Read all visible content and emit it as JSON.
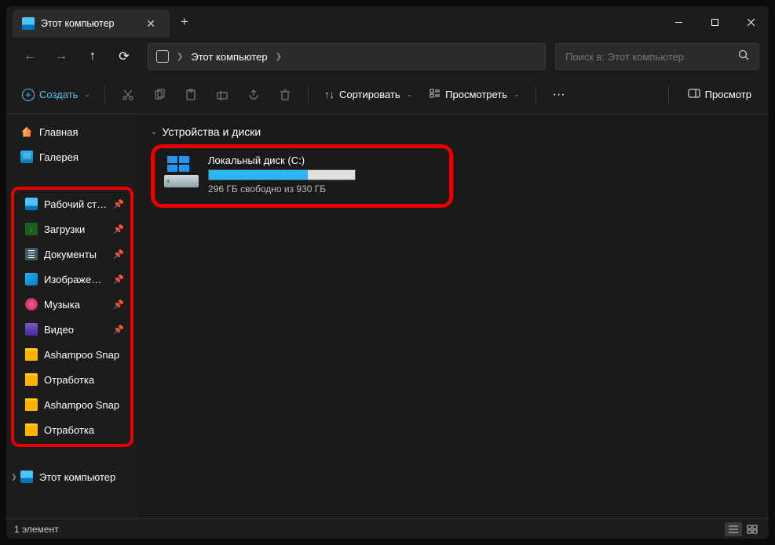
{
  "tab": {
    "title": "Этот компьютер"
  },
  "breadcrumb": {
    "location": "Этот компьютер"
  },
  "search": {
    "placeholder": "Поиск в: Этот компьютер"
  },
  "toolbar": {
    "create": "Создать",
    "sort": "Сортировать",
    "view": "Просмотреть",
    "preview": "Просмотр"
  },
  "sidebar": {
    "top": [
      {
        "label": "Главная",
        "icon": "home"
      },
      {
        "label": "Галерея",
        "icon": "gallery"
      }
    ],
    "pinned": [
      {
        "label": "Рабочий стол",
        "icon": "desktop",
        "pin": true
      },
      {
        "label": "Загрузки",
        "icon": "download",
        "pin": true
      },
      {
        "label": "Документы",
        "icon": "docs",
        "pin": true
      },
      {
        "label": "Изображения",
        "icon": "images",
        "pin": true
      },
      {
        "label": "Музыка",
        "icon": "music",
        "pin": true
      },
      {
        "label": "Видео",
        "icon": "video",
        "pin": true
      },
      {
        "label": "Ashampoo Snap",
        "icon": "folder",
        "pin": false
      },
      {
        "label": "Отработка",
        "icon": "folder",
        "pin": false
      },
      {
        "label": "Ashampoo Snap",
        "icon": "folder",
        "pin": false
      },
      {
        "label": "Отработка",
        "icon": "folder",
        "pin": false
      }
    ],
    "bottom": [
      {
        "label": "Этот компьютер",
        "icon": "pc",
        "expandable": true
      }
    ]
  },
  "section": {
    "title": "Устройства и диски"
  },
  "drive": {
    "name": "Локальный диск (C:)",
    "status": "296 ГБ свободно из 930 ГБ",
    "used_percent": 68
  },
  "status": {
    "count": "1 элемент"
  }
}
